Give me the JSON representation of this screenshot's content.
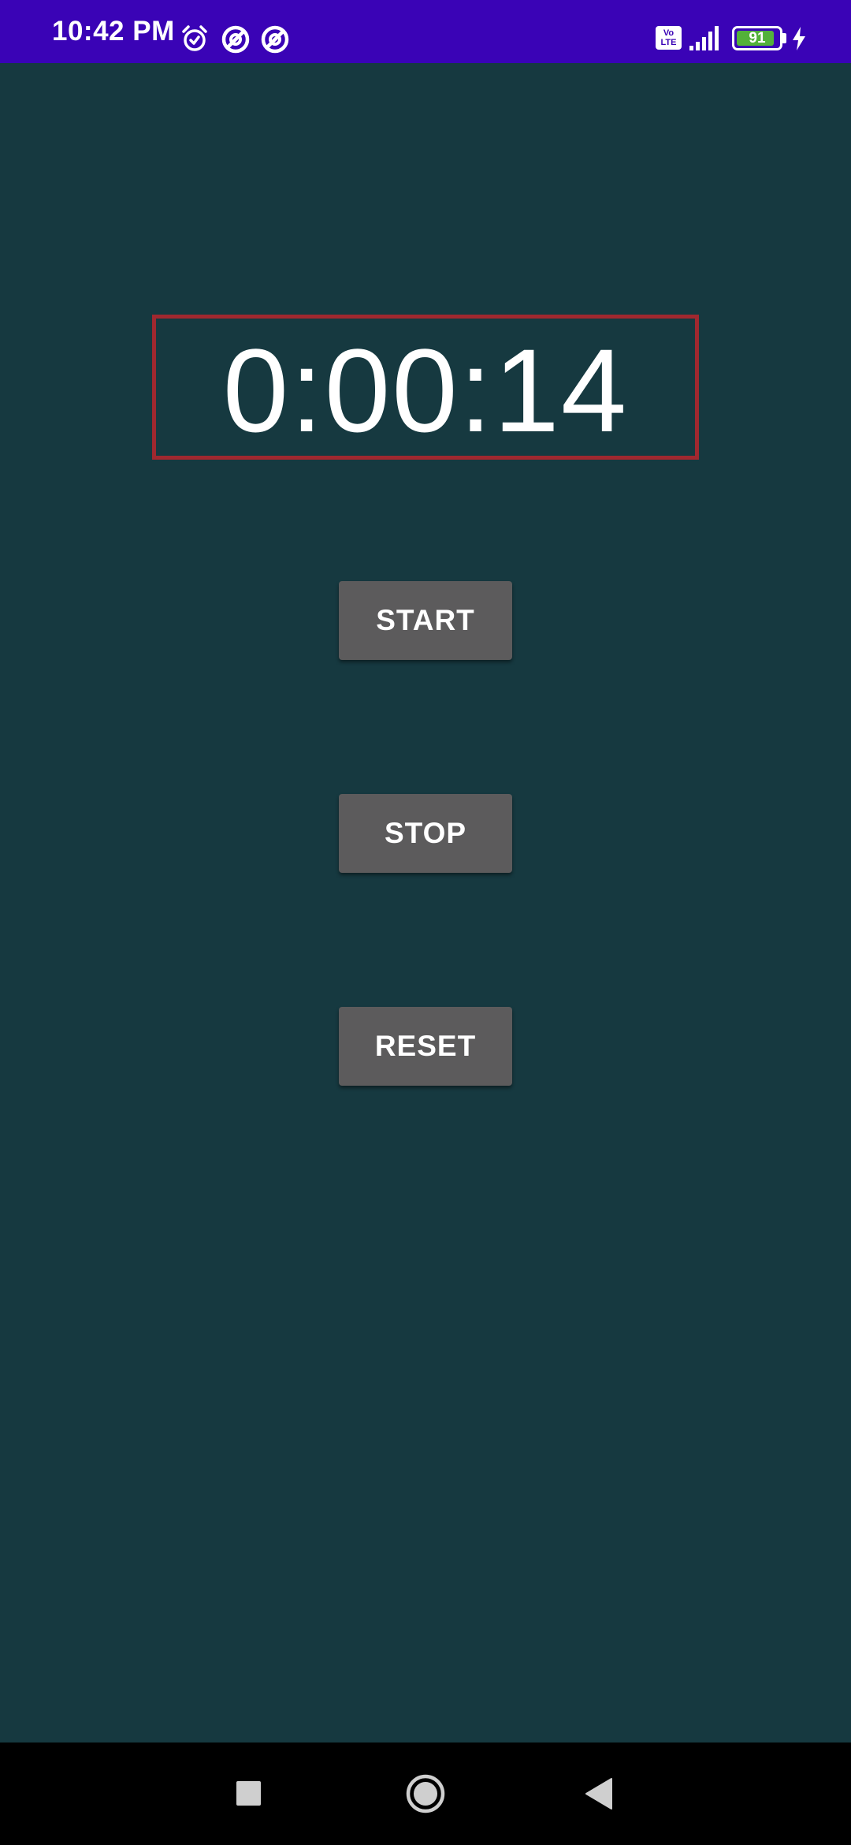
{
  "status_bar": {
    "time": "10:42 PM",
    "icons": [
      "alarm-icon",
      "data-saver-icon",
      "data-saver-icon"
    ],
    "volte_line1": "Vo",
    "volte_line2": "LTE",
    "battery_level": "91",
    "battery_fraction": 0.91,
    "charging": true,
    "background_color": "#3a03b6"
  },
  "stopwatch": {
    "display": "0:00:14",
    "border_color": "#a0282f",
    "background_color": "#163940"
  },
  "buttons": {
    "start_label": "START",
    "stop_label": "STOP",
    "reset_label": "RESET",
    "color": "#5c5b5c"
  },
  "nav_bar": {
    "icons": [
      "recents-icon",
      "home-icon",
      "back-icon"
    ]
  }
}
